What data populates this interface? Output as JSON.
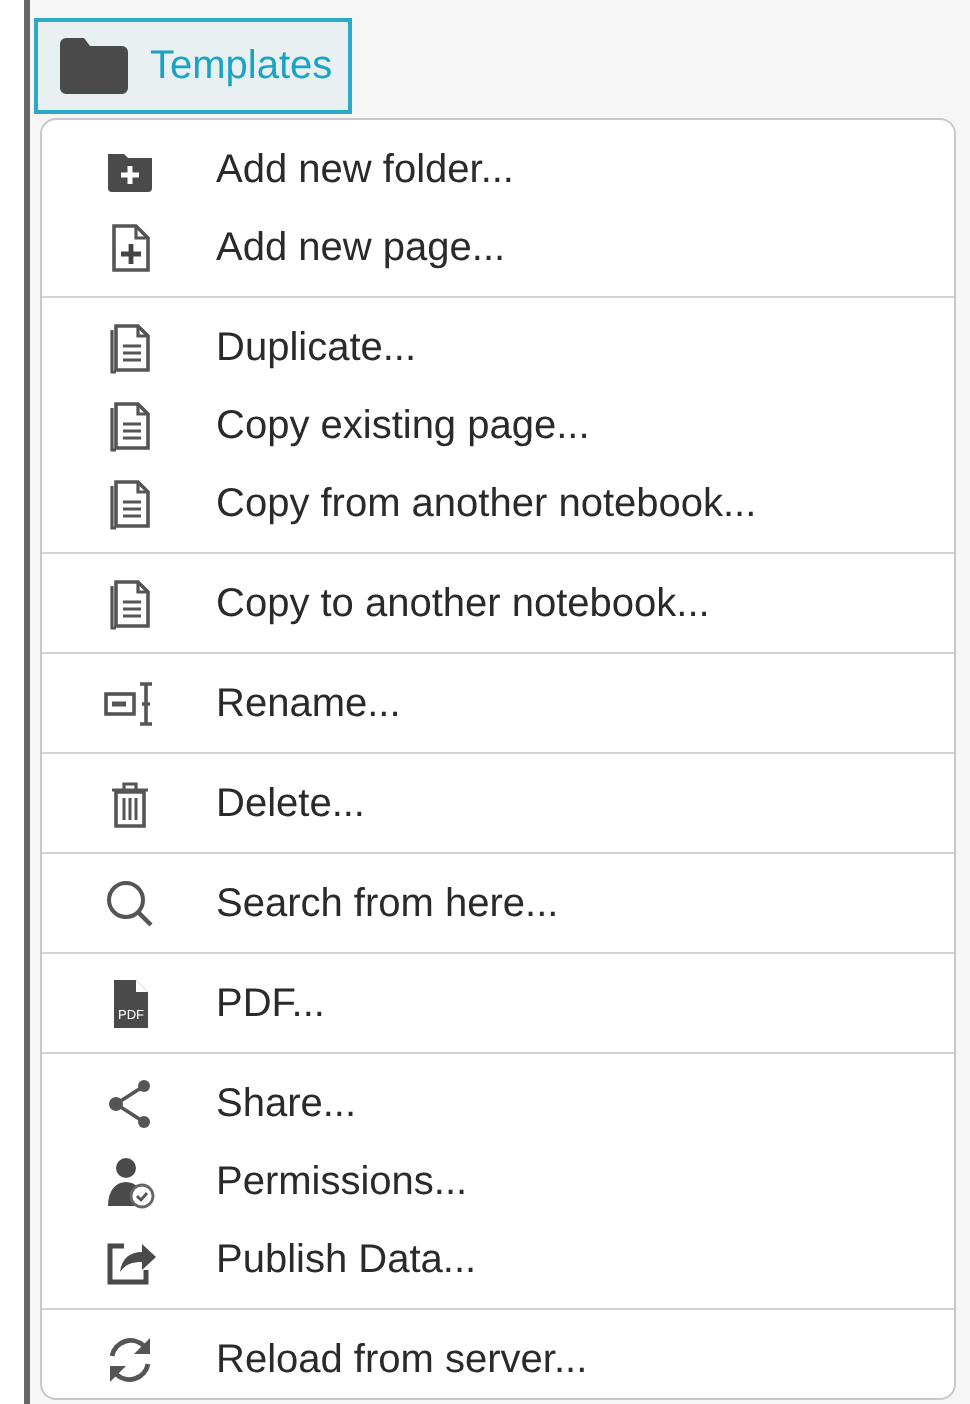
{
  "folder_button": {
    "label": "Templates",
    "selected": true
  },
  "menu": {
    "groups": [
      {
        "items": [
          {
            "kind": "folder-plus",
            "label": "Add new folder..."
          },
          {
            "kind": "page-plus",
            "label": "Add new page..."
          }
        ]
      },
      {
        "items": [
          {
            "kind": "pages",
            "label": "Duplicate..."
          },
          {
            "kind": "pages",
            "label": "Copy existing page..."
          },
          {
            "kind": "pages",
            "label": "Copy from another notebook..."
          }
        ]
      },
      {
        "items": [
          {
            "kind": "pages",
            "label": "Copy to another notebook..."
          }
        ]
      },
      {
        "items": [
          {
            "kind": "rename",
            "label": "Rename..."
          }
        ]
      },
      {
        "items": [
          {
            "kind": "trash",
            "label": "Delete..."
          }
        ]
      },
      {
        "items": [
          {
            "kind": "search",
            "label": "Search from here..."
          }
        ]
      },
      {
        "items": [
          {
            "kind": "pdf",
            "icon_text": "PDF",
            "label": "PDF..."
          }
        ]
      },
      {
        "items": [
          {
            "kind": "share",
            "label": "Share..."
          },
          {
            "kind": "user-check",
            "label": "Permissions..."
          },
          {
            "kind": "export",
            "label": "Publish Data..."
          }
        ]
      },
      {
        "items": [
          {
            "kind": "refresh",
            "label": "Reload from server..."
          }
        ]
      }
    ]
  }
}
